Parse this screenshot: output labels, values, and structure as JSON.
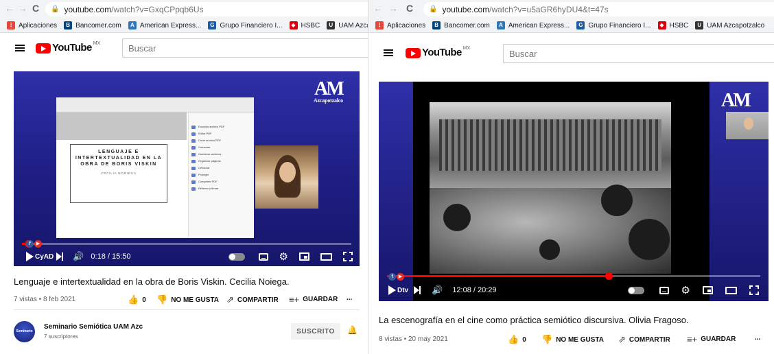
{
  "colors": {
    "accent_red": "#ff0000",
    "player_blue": "#1f1f86",
    "chrome_bg": "#f1f3f4"
  },
  "bookmarks": [
    {
      "label": "Aplicaciones",
      "icon": "apps-grid-icon",
      "color": "#e8453c"
    },
    {
      "label": "Bancomer.com",
      "icon": "bancomer-icon",
      "color": "#004481"
    },
    {
      "label": "American Express...",
      "icon": "amex-icon",
      "color": "#2e77bb"
    },
    {
      "label": "Grupo Financiero I...",
      "icon": "inbursa-icon",
      "color": "#1b5aa6"
    },
    {
      "label": "HSBC",
      "icon": "hsbc-icon",
      "color": "#db0011"
    },
    {
      "label": "UAM Azcapotzalco",
      "icon": "uam-icon",
      "color": "#333333"
    }
  ],
  "left": {
    "url_host": "youtube.com",
    "url_path": "/watch?v=GxqCPpqb6Us",
    "logo_text": "YouTube",
    "logo_country": "MX",
    "search_placeholder": "Buscar",
    "video": {
      "uam_logo": "AM",
      "uam_word": "Azcapotzalco",
      "slide_title": "LENGUAJE E INTERTEXTUALIDAD EN LA OBRA DE BORIS VISKIN",
      "slide_author": "CECILIA NORIEGA",
      "pdf_menu": [
        "Exportar archivo PDF",
        "Editar PDF",
        "Crear archivo PDF",
        "Comentar",
        "Combinar archivos",
        "Organizar páginas",
        "Censurar",
        "Proteger",
        "Comprimir PDF",
        "Rellenar y firmar"
      ],
      "watermark": "CyAD",
      "time": "0:18 / 15:50",
      "progress": 0.019
    },
    "title": "Lenguaje e intertextualidad en la obra de Boris Viskin. Cecilia Noiega.",
    "views": "7 vistas • 8 feb 2021",
    "like_count": "0",
    "dislike_label": "NO ME GUSTA",
    "share_label": "COMPARTIR",
    "save_label": "GUARDAR",
    "more_label": "...",
    "channel_name": "Seminario Semiótica UAM Azc",
    "channel_subs": "7 suscriptores",
    "avatar_text": "Seminario",
    "subscribed_label": "SUSCRITO"
  },
  "right": {
    "url_host": "youtube.com",
    "url_path": "/watch?v=u5aGR6hyDU4&t=47s",
    "logo_text": "YouTube",
    "logo_country": "MX",
    "search_placeholder": "Buscar",
    "video": {
      "uam_logo": "AM",
      "watermark": "Dtv",
      "time": "12:08 / 20:29",
      "progress": 0.593
    },
    "title": "La escenografía en el cine como práctica semiótico discursiva. Olivia Fragoso.",
    "views": "8 vistas • 20 may 2021",
    "like_count": "0",
    "dislike_label": "NO ME GUSTA",
    "share_label": "COMPARTIR",
    "save_label": "GUARDAR",
    "more_label": "..."
  }
}
